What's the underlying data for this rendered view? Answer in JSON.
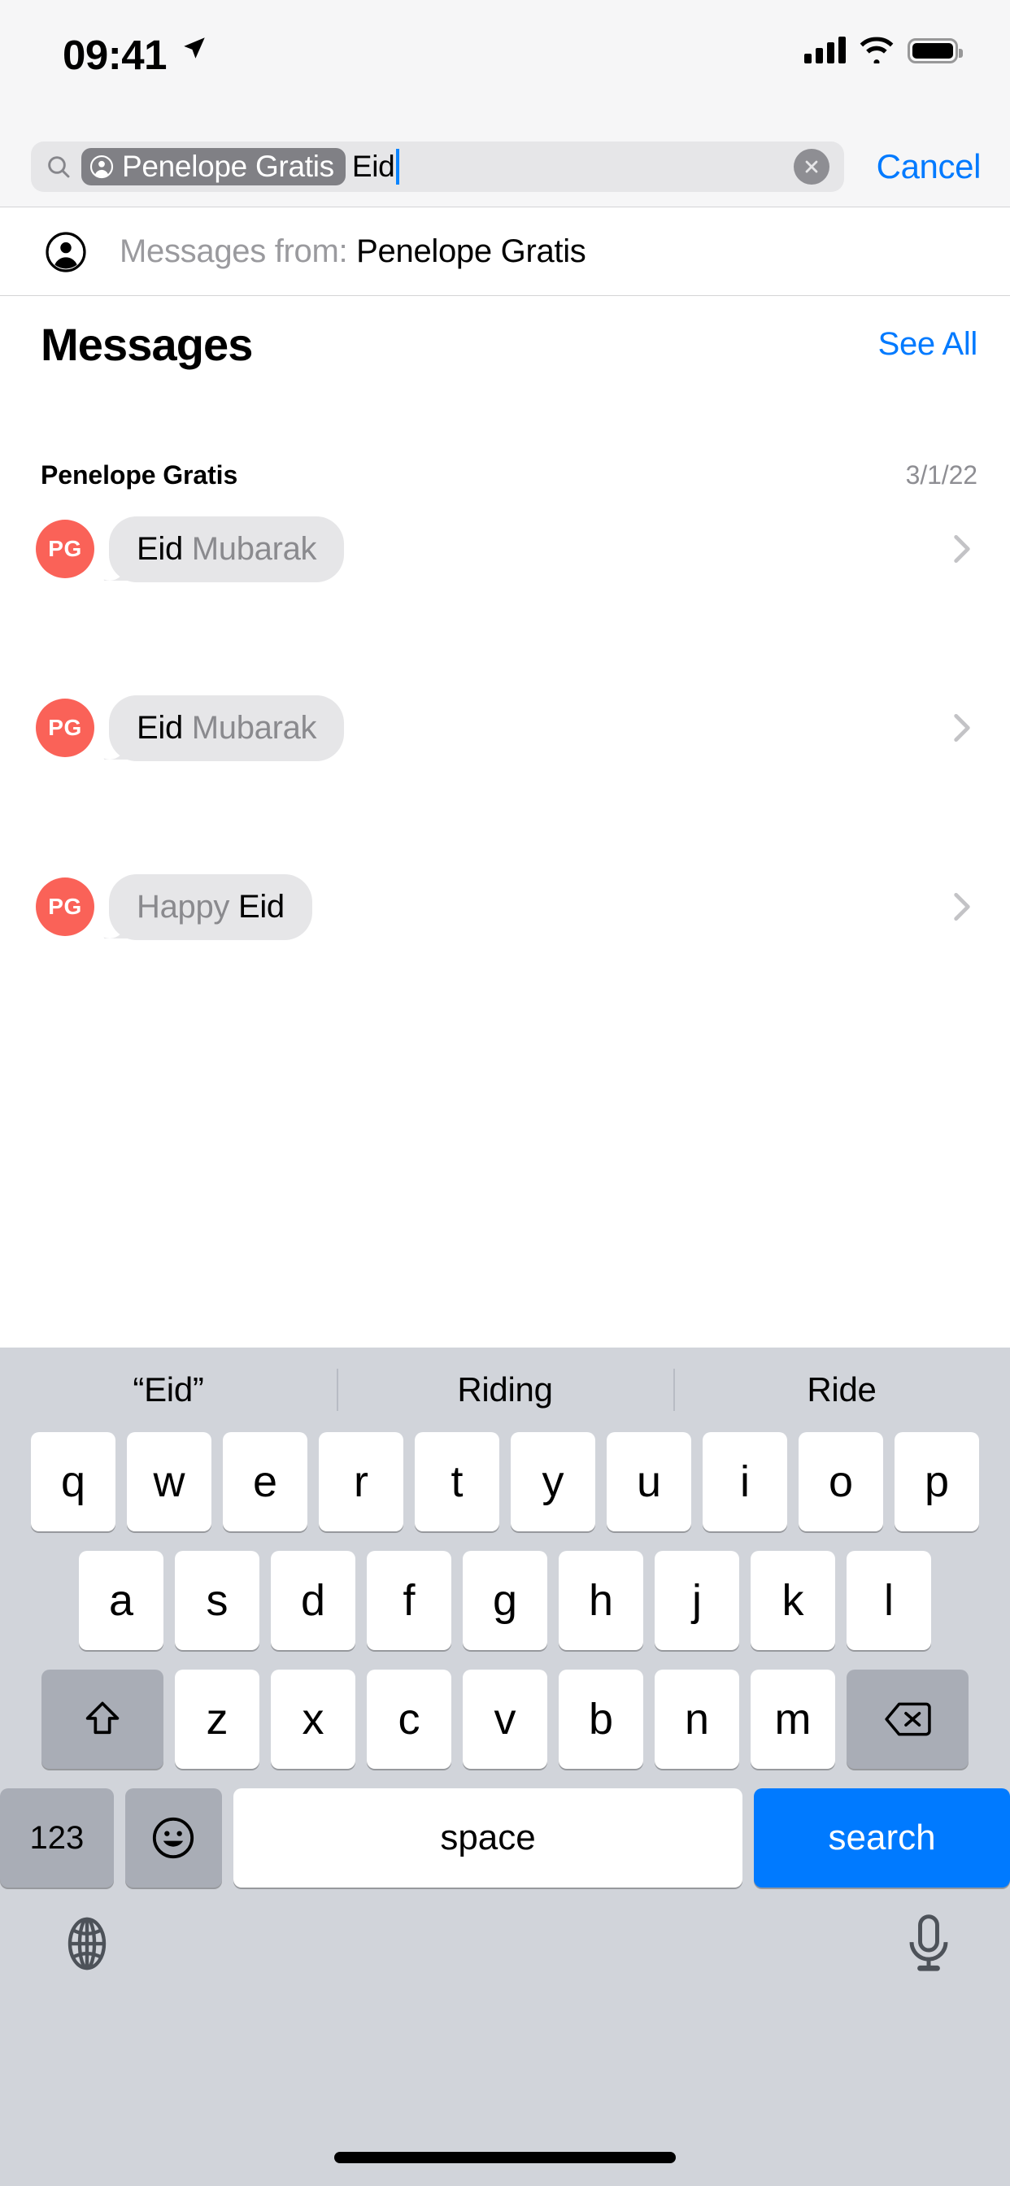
{
  "status_bar": {
    "time": "09:41",
    "location_icon": "location-arrow-icon",
    "cellular_icon": "cellular-bars-icon",
    "wifi_icon": "wifi-icon",
    "battery_icon": "battery-full-icon"
  },
  "search": {
    "search_icon": "search-icon",
    "token_icon": "person-circle-icon",
    "token_label": "Penelope Gratis",
    "query_text": "Eid",
    "clear_icon": "clear-circle-icon",
    "cancel_label": "Cancel"
  },
  "suggestion": {
    "icon": "person-circle-icon",
    "prefix": "Messages from:",
    "name": "Penelope Gratis"
  },
  "section": {
    "title": "Messages",
    "see_all_label": "See All"
  },
  "conversation": {
    "name": "Penelope Gratis",
    "date": "3/1/22"
  },
  "results": [
    {
      "avatar_initials": "PG",
      "avatar_color": "#fa6258",
      "highlight": "Eid",
      "rest": " Mubarak",
      "highlight_first": true,
      "chevron_icon": "chevron-right-icon"
    },
    {
      "avatar_initials": "PG",
      "avatar_color": "#fa6258",
      "highlight": "Eid",
      "rest": " Mubarak",
      "highlight_first": true,
      "chevron_icon": "chevron-right-icon"
    },
    {
      "avatar_initials": "PG",
      "avatar_color": "#fa6258",
      "highlight": "Eid",
      "rest": "Happy ",
      "highlight_first": false,
      "chevron_icon": "chevron-right-icon"
    }
  ],
  "keyboard": {
    "predictions": [
      "“Eid”",
      "Riding",
      "Ride"
    ],
    "row1": [
      "q",
      "w",
      "e",
      "r",
      "t",
      "y",
      "u",
      "i",
      "o",
      "p"
    ],
    "row2": [
      "a",
      "s",
      "d",
      "f",
      "g",
      "h",
      "j",
      "k",
      "l"
    ],
    "row3": [
      "z",
      "x",
      "c",
      "v",
      "b",
      "n",
      "m"
    ],
    "shift_icon": "shift-arrow-icon",
    "backspace_icon": "backspace-delete-icon",
    "numbers_label": "123",
    "emoji_icon": "emoji-smiley-icon",
    "space_label": "space",
    "search_label": "search",
    "globe_icon": "globe-language-icon",
    "mic_icon": "microphone-icon"
  },
  "colors": {
    "ios_blue": "#007aff",
    "bubble_gray": "#e6e6e8",
    "token_gray": "#808085",
    "keyboard_bg": "#d1d4da"
  }
}
